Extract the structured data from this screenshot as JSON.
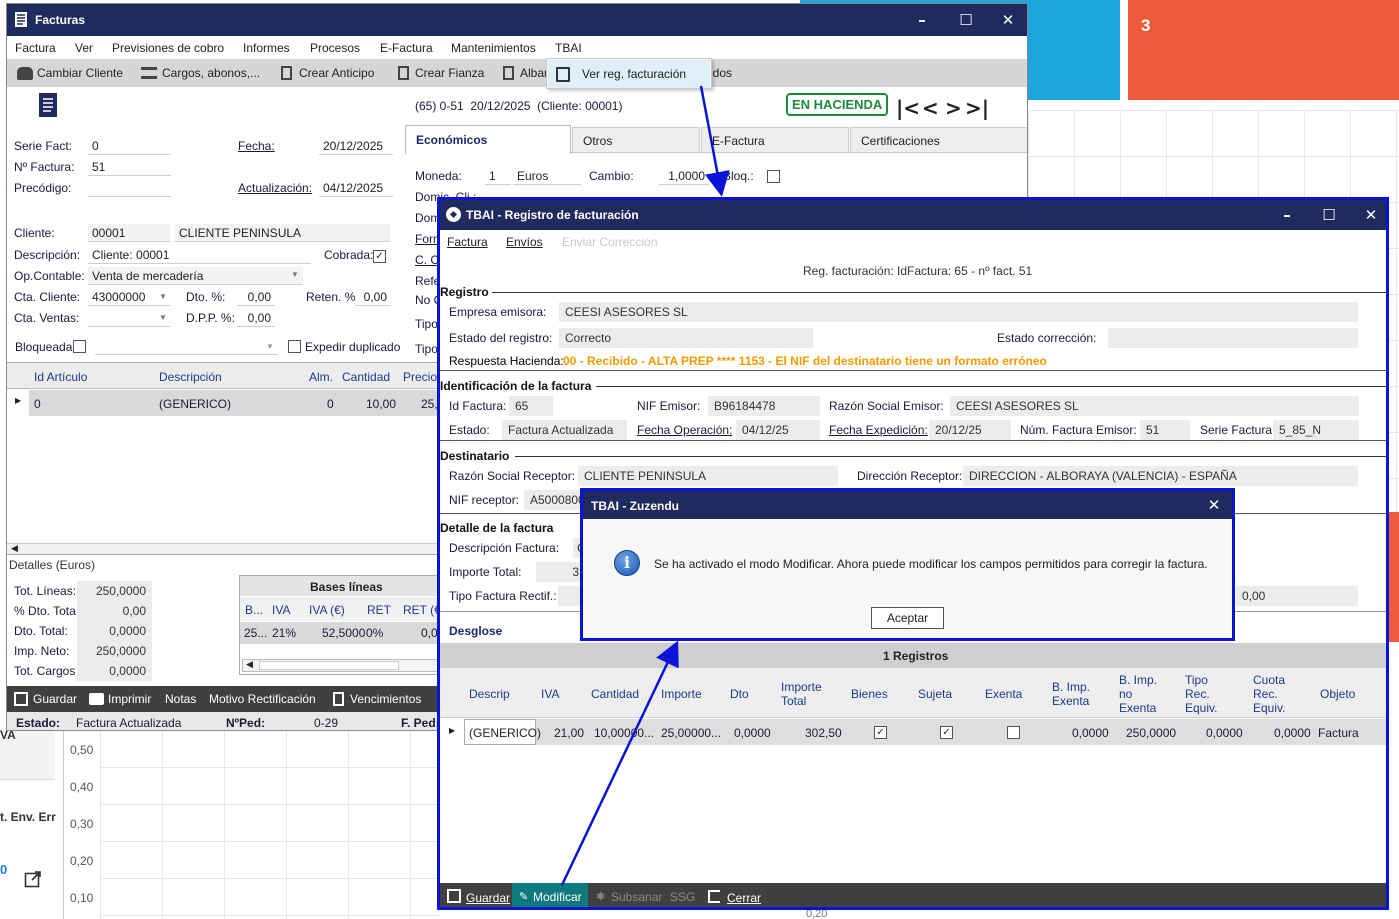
{
  "background": {
    "tile_value": "3",
    "axis_ticks": [
      "0,50",
      "0,40",
      "0,30",
      "0,20",
      "0,10"
    ],
    "left_text_iva": "VA",
    "left_text_env": "t. Env. Err",
    "badge": "0",
    "bottom_cut_value": "0,20"
  },
  "facturas": {
    "title": "Facturas",
    "menu": [
      "Factura",
      "Ver",
      "Previsiones de cobro",
      "Informes",
      "Procesos",
      "E-Factura",
      "Mantenimientos",
      "TBAI"
    ],
    "toolbar": [
      "Cambiar Cliente",
      "Cargos, abonos,...",
      "Crear Anticipo",
      "Crear Fianza",
      "Albar",
      "idos"
    ],
    "dropdown_item": "Ver reg. facturación",
    "header_info": "(65) 0-51  20/12/2025  (Cliente: 00001)",
    "status_stamp": "EN HACIENDA",
    "labels": {
      "serie": "Serie Fact:",
      "numero": "Nº Factura:",
      "precodigo": "Precódigo:",
      "fecha": "Fecha:",
      "actualizacion": "Actualización:",
      "cliente": "Cliente:",
      "descripcion": "Descripción:",
      "cobrada": "Cobrada:",
      "opcontable": "Op.Contable:",
      "cta_cliente": "Cta. Cliente:",
      "dto": "Dto. %:",
      "reten": "Reten. %",
      "cta_ventas": "Cta. Ventas:",
      "dpp": "D.P.P. %:",
      "bloqueada": "Bloqueada",
      "expedir": "Expedir duplicado"
    },
    "values": {
      "serie": "0",
      "numero": "51",
      "fecha": "20/12/2025",
      "actualizacion": "04/12/2025",
      "cliente_code": "00001",
      "cliente_name": "CLIENTE PENINSULA",
      "descripcion": "Cliente: 00001",
      "opcontable": "Venta de mercadería",
      "cta_cliente": "43000000",
      "dto": "0,00",
      "reten": "0,00",
      "dpp": "0,00"
    },
    "tabs": [
      "Económicos",
      "Otros",
      "E-Factura",
      "Certificaciones"
    ],
    "economicos": {
      "moneda_label": "Moneda:",
      "moneda_code": "1",
      "moneda_name": "Euros",
      "cambio_label": "Cambio:",
      "cambio": "1,0000",
      "bloq_label": "Bloq.:",
      "partial_labels": [
        "Domic. Cli.:",
        "Dom",
        "Form",
        "C. C",
        "Refe",
        "No C",
        "Tipo",
        "Tipo"
      ]
    },
    "grid": {
      "headers": [
        "Id Artículo",
        "Descripción",
        "Alm.",
        "Cantidad",
        "Precio"
      ],
      "row": [
        "0",
        "(GENERICO)",
        "0",
        "10,00",
        "25,"
      ]
    },
    "detalles_title": "Detalles (Euros)",
    "totals": [
      {
        "label": "Tot. Líneas:",
        "value": "250,0000"
      },
      {
        "label": "% Dto. Tota",
        "value": "0,00"
      },
      {
        "label": "Dto. Total:",
        "value": "0,0000"
      },
      {
        "label": "Imp. Neto:",
        "value": "250,0000"
      },
      {
        "label": "Tot. Cargos",
        "value": "0,0000"
      }
    ],
    "bases": {
      "title": "Bases líneas",
      "headers": [
        "B...",
        "IVA",
        "IVA (€)",
        "RET",
        "RET (€"
      ],
      "row": [
        "25...",
        "21%",
        "52,5000",
        "0%",
        "0,0"
      ]
    },
    "bottom_bar": [
      "Guardar",
      "Imprimir",
      "Notas",
      "Motivo Rectificación",
      "Vencimientos"
    ],
    "status": {
      "estado_label": "Estado:",
      "estado": "Factura Actualizada",
      "nped_label": "NºPed:",
      "nped": "0-29",
      "fped_label": "F. Ped:"
    }
  },
  "tbai": {
    "title": "TBAI - Registro de facturación",
    "menu": [
      "Factura",
      "Envíos",
      "Enviar Corrección"
    ],
    "info": "Reg. facturación: IdFactura: 65 - nº fact. 51",
    "registro": {
      "section": "Registro",
      "empresa_label": "Empresa emisora:",
      "empresa": "CEESI ASESORES SL",
      "estado_label": "Estado del registro:",
      "estado": "Correcto",
      "correccion_label": "Estado corrección:",
      "respuesta_label": "Respuesta Hacienda:",
      "respuesta": "00 - Recibido - ALTA PREP **** 1153 - El NIF del destinatario tiene un formato erróneo"
    },
    "identificacion": {
      "section": "Identificación de la factura",
      "id_label": "Id Factura:",
      "id": "65",
      "nif_label": "NIF Emisor:",
      "nif": "B96184478",
      "razon_label": "Razón Social Emisor:",
      "razon": "CEESI ASESORES SL",
      "estado_label": "Estado:",
      "estado": "Factura Actualizada",
      "fop_label": "Fecha Operación:",
      "fop": "04/12/25",
      "fexp_label": "Fecha Expedición:",
      "fexp": "20/12/25",
      "num_label": "Núm. Factura Emisor:",
      "num": "51",
      "serie_label": "Serie Factura:",
      "serie": "5_85_N"
    },
    "destinatario": {
      "section": "Destinatario",
      "razon_label": "Razón Social Receptor:",
      "razon": "CLIENTE PENINSULA",
      "dir_label": "Dirección Receptor:",
      "dir": "DIRECCION - ALBORAYA (VALENCIA) - ESPAÑA",
      "nif_label": "NIF receptor:",
      "nif": "A5000800"
    },
    "detalle": {
      "section": "Detalle de la factura",
      "desc_label": "Descripción Factura:",
      "desc": "C",
      "importe_label": "Importe Total:",
      "importe": "3",
      "tipo_label": "Tipo Factura Rectif.:",
      "right_value": "0,00"
    },
    "desglose": {
      "section": "Desglose",
      "count": "1 Registros",
      "headers": [
        "Descrip",
        "IVA",
        "Cantidad",
        "Importe",
        "Dto",
        "Importe Total",
        "Bienes",
        "Sujeta",
        "Exenta",
        "B. Imp. Exenta",
        "B. Imp. no Exenta",
        "Tipo Rec. Equiv.",
        "Cuota Rec. Equiv.",
        "Objeto"
      ],
      "row": [
        "(GENERICO)",
        "21,00",
        "10,00000...",
        "25,00000...",
        "0,0000",
        "302,50",
        "✓",
        "✓",
        "",
        "0,0000",
        "250,0000",
        "0,0000",
        "0,0000",
        "Factura"
      ]
    },
    "bottom_bar": [
      "Guardar",
      "Modificar",
      "Subsanar",
      "SSG",
      "Cerrar"
    ]
  },
  "dialog": {
    "title": "TBAI - Zuzendu",
    "message": "Se ha activado el modo Modificar. Ahora puede modificar los campos permitidos para corregir la factura.",
    "ok": "Aceptar"
  },
  "colors": {
    "titlebar": "#1f2a5e",
    "accent_blue": "#0a14d6",
    "tile_orange": "#ef5a3c",
    "tile_cyan": "#1ca6dc",
    "response_orange": "#f29b00",
    "stamp_green": "#1e8a3c",
    "modificar_bg": "#0e7a7e"
  }
}
